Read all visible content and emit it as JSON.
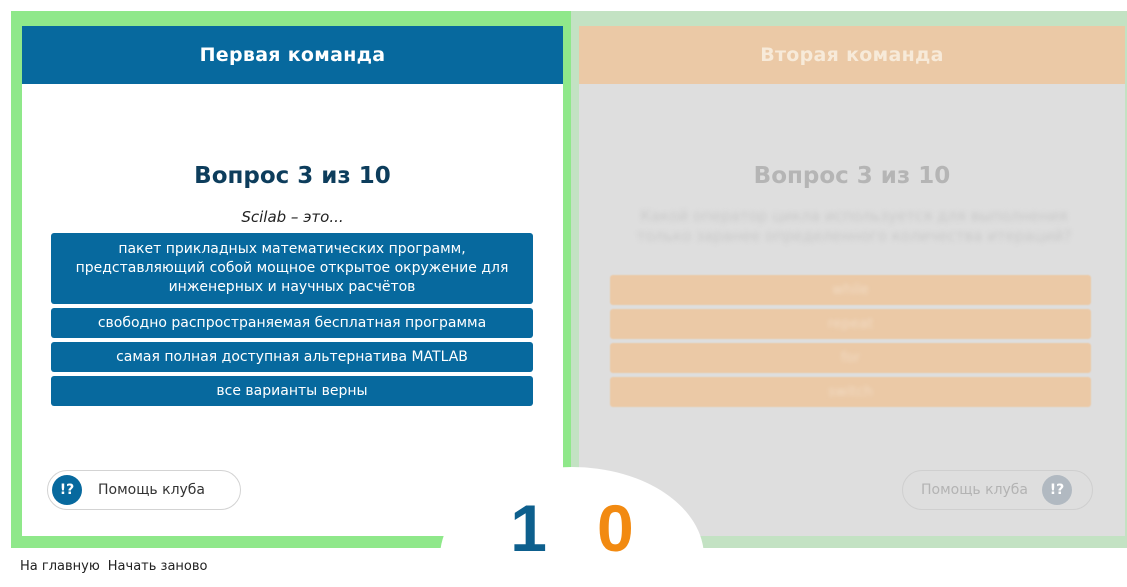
{
  "team_left": {
    "title": "Первая команда",
    "question_counter": "Вопрос 3 из 10",
    "question": "Scilab – это...",
    "answers": [
      "пакет прикладных математических программ, представляющий собой мощное открытое окружение для инженерных и научных расчётов",
      "свободно распространяемая бесплатная программа",
      "самая полная доступная альтернатива MATLAB",
      "все варианты верны"
    ],
    "help_label": "Помощь клуба",
    "help_icon": "!?"
  },
  "team_right": {
    "title": "Вторая команда",
    "question_counter": "Вопрос 3 из 10",
    "question": "Какой оператор цикла используется для выполнения только заранее определенного количества итераций?",
    "answers": [
      "while",
      "repeat",
      "for",
      "switch"
    ],
    "help_label": "Помощь клуба",
    "help_icon": "!?"
  },
  "score": {
    "left": "1",
    "right": "0"
  },
  "footer": {
    "home": "На главную",
    "restart": "Начать заново"
  },
  "colors": {
    "team_left_accent": "#07699e",
    "team_right_accent": "#ebc9a6",
    "active_frame": "#8fe88a",
    "score_left": "#0d5f8d",
    "score_right": "#f28a11"
  }
}
